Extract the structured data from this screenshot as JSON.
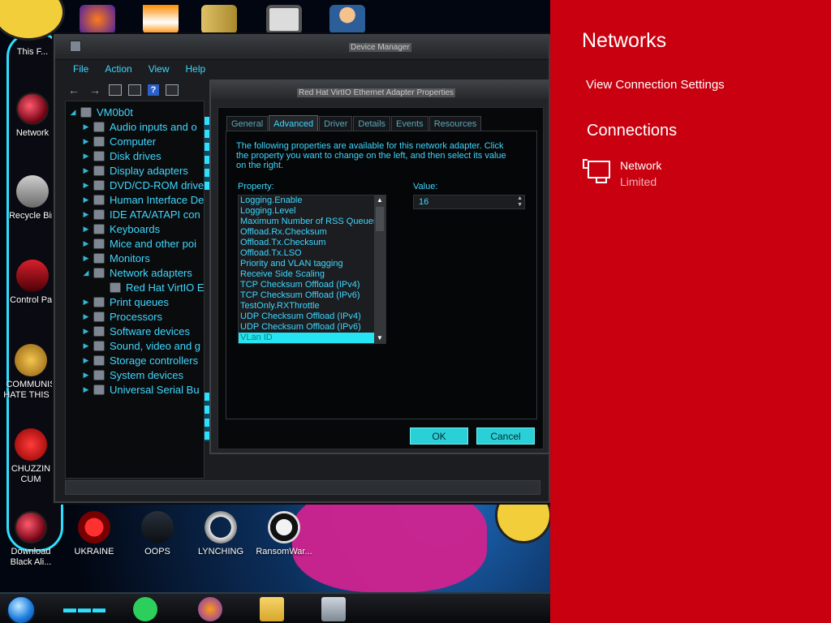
{
  "desktop": {
    "icons": [
      {
        "id": "thisfolder",
        "label": "This F...",
        "icon": "avatar-folder-icon"
      },
      {
        "id": "network",
        "label": "Network",
        "icon": "network-orb-icon"
      },
      {
        "id": "recycle",
        "label": "Recycle Bin",
        "icon": "recycle-bin-icon"
      },
      {
        "id": "control",
        "label": "Control Par",
        "icon": "control-panel-icon"
      },
      {
        "id": "communism",
        "label": "COMMUNIS HATE THIS C",
        "icon": "money-bag-icon"
      },
      {
        "id": "chuzzin",
        "label": "CHUZZIN CUM",
        "icon": "red-fuzzball-icon"
      },
      {
        "id": "download",
        "label": "Download Black Ali...",
        "icon": "red-orb-icon"
      },
      {
        "id": "ukraine",
        "label": "UKRAINE",
        "icon": "radiation-icon"
      },
      {
        "id": "oops",
        "label": "OOPS",
        "icon": "computer-icon"
      },
      {
        "id": "lynching",
        "label": "LYNCHING",
        "icon": "rope-icon"
      },
      {
        "id": "ransomware",
        "label": "RansomWar...",
        "icon": "skull-icon"
      }
    ]
  },
  "device_manager": {
    "title": "Device Manager",
    "menu": [
      "File",
      "Action",
      "View",
      "Help"
    ],
    "tree": {
      "root": "VM0b0t",
      "items": [
        {
          "label": "Audio inputs and o",
          "expanded": false
        },
        {
          "label": "Computer",
          "expanded": false
        },
        {
          "label": "Disk drives",
          "expanded": false
        },
        {
          "label": "Display adapters",
          "expanded": false
        },
        {
          "label": "DVD/CD-ROM drive",
          "expanded": false
        },
        {
          "label": "Human Interface De",
          "expanded": false
        },
        {
          "label": "IDE ATA/ATAPI con",
          "expanded": false
        },
        {
          "label": "Keyboards",
          "expanded": false
        },
        {
          "label": "Mice and other poi",
          "expanded": false
        },
        {
          "label": "Monitors",
          "expanded": false
        },
        {
          "label": "Network adapters",
          "expanded": true
        },
        {
          "label": "Red Hat VirtIO E",
          "child": true
        },
        {
          "label": "Print queues",
          "expanded": false
        },
        {
          "label": "Processors",
          "expanded": false
        },
        {
          "label": "Software devices",
          "expanded": false
        },
        {
          "label": "Sound, video and g",
          "expanded": false
        },
        {
          "label": "Storage controllers",
          "expanded": false
        },
        {
          "label": "System devices",
          "expanded": false
        },
        {
          "label": "Universal Serial Bu",
          "expanded": false
        }
      ]
    }
  },
  "properties_dialog": {
    "title": "Red Hat VirtIO Ethernet Adapter Properties",
    "tabs": [
      "General",
      "Advanced",
      "Driver",
      "Details",
      "Events",
      "Resources"
    ],
    "active_tab": "Advanced",
    "description": "The following properties are available for this network adapter. Click the property you want to change on the left, and then select its value on the right.",
    "property_label": "Property:",
    "value_label": "Value:",
    "properties": [
      "Logging.Enable",
      "Logging.Level",
      "Maximum Number of RSS Queues",
      "Offload.Rx.Checksum",
      "Offload.Tx.Checksum",
      "Offload.Tx.LSO",
      "Priority and VLAN tagging",
      "Receive Side Scaling",
      "TCP Checksum Offload (IPv4)",
      "TCP Checksum Offload (IPv6)",
      "TestOnly.RXThrottle",
      "UDP Checksum Offload (IPv4)",
      "UDP Checksum Offload (IPv6)",
      "VLan ID"
    ],
    "selected_property": "VLan ID",
    "value": "16",
    "ok_label": "OK",
    "cancel_label": "Cancel"
  },
  "network_panel": {
    "title": "Networks",
    "view_settings": "View Connection Settings",
    "connections_heading": "Connections",
    "connection": {
      "name": "Network",
      "status": "Limited"
    },
    "background": "#c8000f"
  },
  "taskbar": {
    "apps": [
      "start-orb-icon",
      "spotify-icon",
      "firefox-icon",
      "file-explorer-icon",
      "device-manager-icon"
    ]
  }
}
